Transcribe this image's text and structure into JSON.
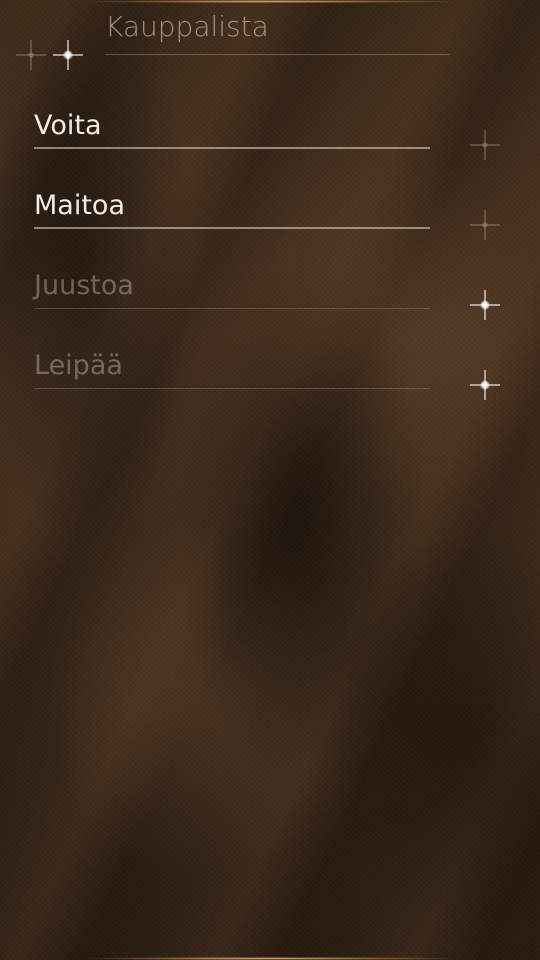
{
  "header": {
    "title": "Kauppalista"
  },
  "list": {
    "items": [
      {
        "label": "Voita",
        "checked": false
      },
      {
        "label": "Maitoa",
        "checked": false
      },
      {
        "label": "Juustoa",
        "checked": true
      },
      {
        "label": "Leipää",
        "checked": true
      }
    ]
  },
  "icons": {
    "menu_indicator": "sparkle-icon",
    "item_state": "sparkle-icon"
  },
  "colors": {
    "accent_glow": "#ffbe78",
    "active_text": "#f2ece6",
    "inactive_text": "#c8b9af"
  }
}
